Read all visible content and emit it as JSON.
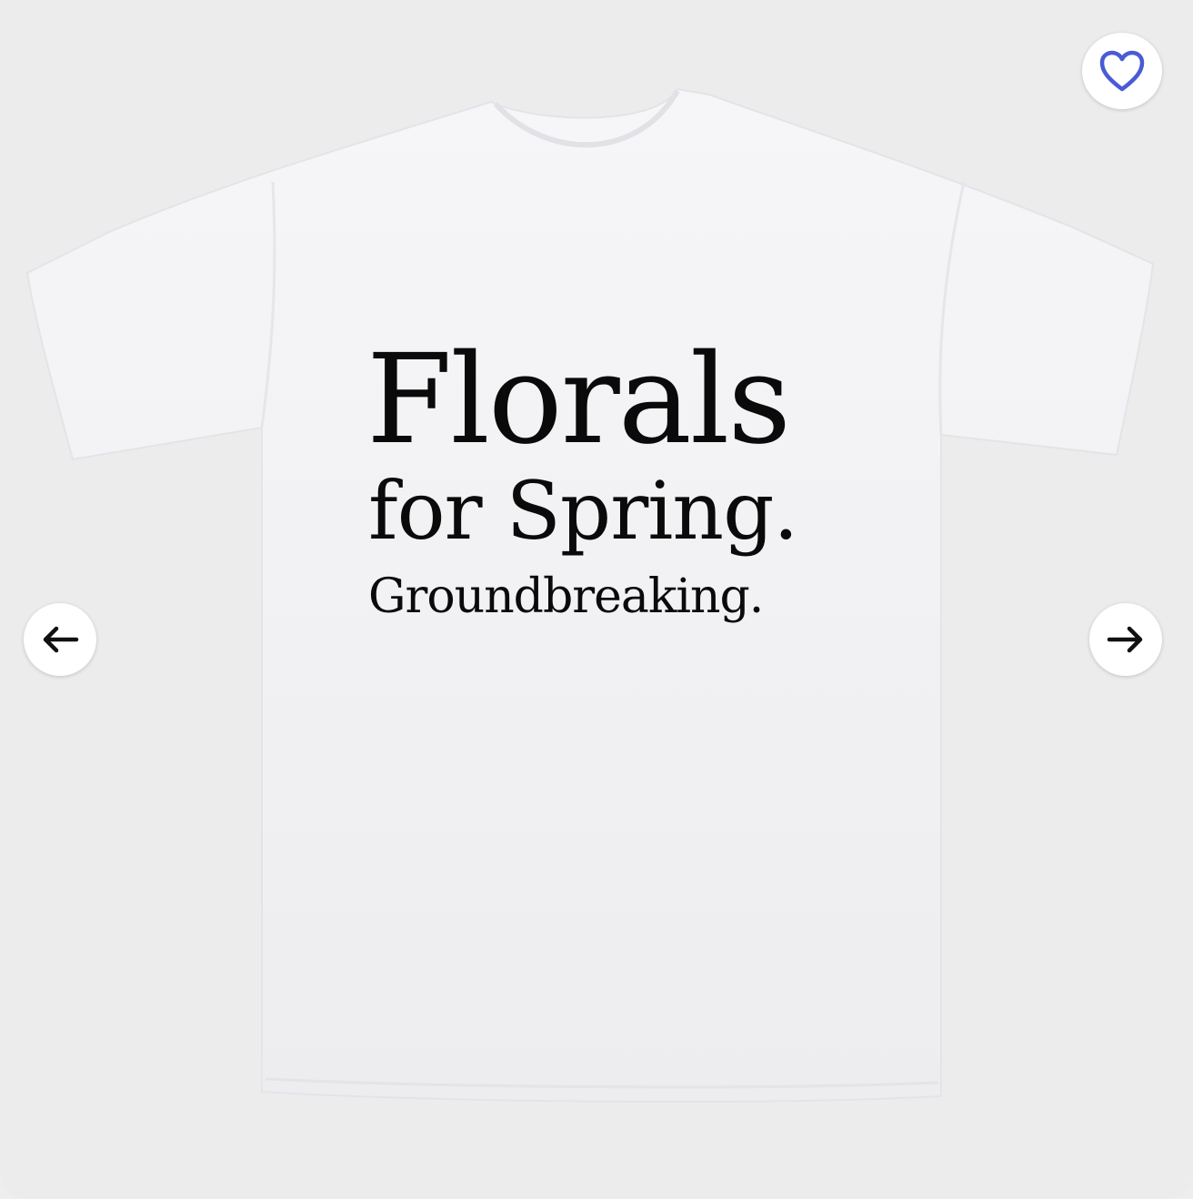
{
  "product": {
    "name": "Florals for Spring. Groundbreaking. T-Shirt",
    "shirt_color": "#f3f3f5",
    "print_lines": [
      "Florals",
      "for Spring.",
      "Groundbreaking."
    ]
  },
  "controls": {
    "favorite_icon": "heart-outline-icon",
    "prev_icon": "arrow-left-icon",
    "next_icon": "arrow-right-icon"
  },
  "colors": {
    "accent": "#4a5bd4",
    "background": "#ececed",
    "ink": "#0a0a0a"
  }
}
